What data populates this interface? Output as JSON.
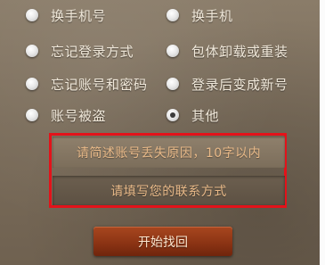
{
  "options": [
    {
      "label": "换手机号",
      "checked": false
    },
    {
      "label": "换手机",
      "checked": false
    },
    {
      "label": "忘记登录方式",
      "checked": false
    },
    {
      "label": "包体卸载或重装",
      "checked": false
    },
    {
      "label": "忘记账号和密码",
      "checked": false
    },
    {
      "label": "登录后变成新号",
      "checked": false
    },
    {
      "label": "账号被盗",
      "checked": false
    },
    {
      "label": "其他",
      "checked": true
    }
  ],
  "form": {
    "reason_placeholder": "请简述账号丢失原因，10字以内",
    "contact_placeholder": "请填写您的联系方式"
  },
  "actions": {
    "start_label": "开始找回"
  },
  "colors": {
    "highlight_border": "#e3121a",
    "button": "#8c3414"
  }
}
